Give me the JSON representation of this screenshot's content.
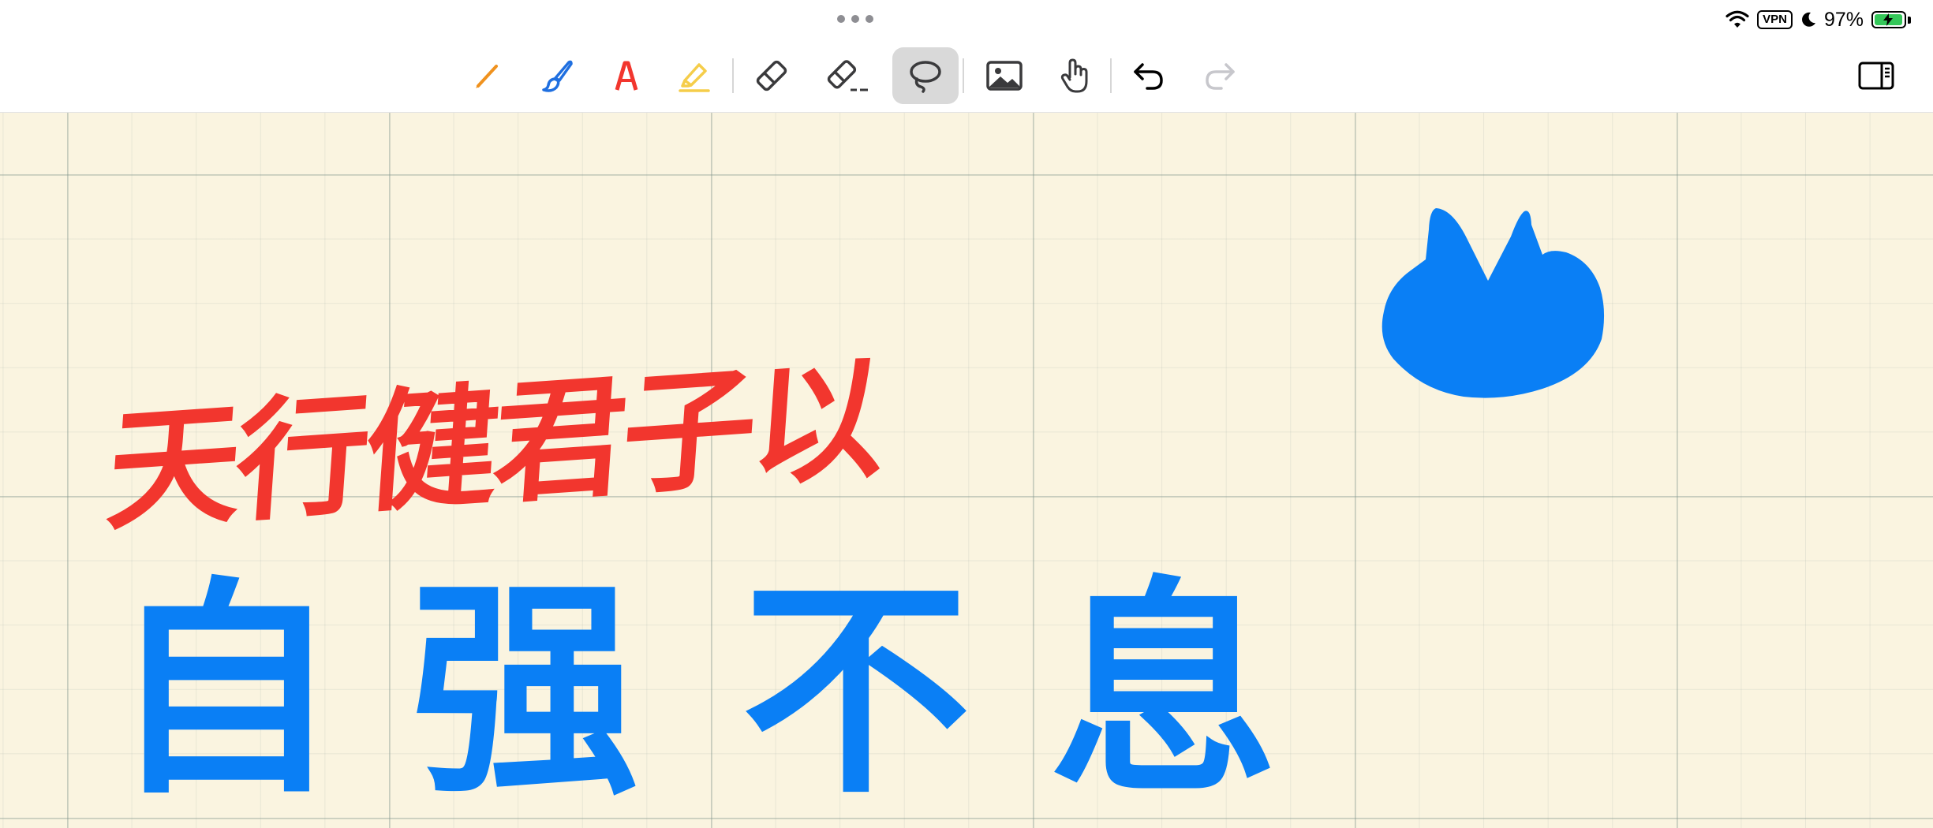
{
  "status_bar": {
    "more_icon": "ellipsis-icon",
    "wifi_icon": "wifi-icon",
    "vpn_label": "VPN",
    "focus_icon": "moon-icon",
    "battery_percent": "97%",
    "battery_level": 0.97,
    "battery_icon": "battery-charging-icon"
  },
  "toolbar": {
    "tools": [
      {
        "id": "pencil",
        "icon": "pencil-icon",
        "color": "#f0921e"
      },
      {
        "id": "brush",
        "icon": "brush-icon",
        "color": "#1f6fe0"
      },
      {
        "id": "pen",
        "icon": "pen-nib-icon",
        "color": "#f2362e"
      },
      {
        "id": "highlighter",
        "icon": "highlighter-icon",
        "color": "#f5cd4a"
      },
      {
        "id": "eraser",
        "icon": "eraser-icon"
      },
      {
        "id": "partial-eraser",
        "icon": "partial-eraser-icon"
      },
      {
        "id": "lasso",
        "icon": "lasso-icon",
        "active": true
      },
      {
        "id": "image",
        "icon": "image-icon"
      },
      {
        "id": "hand",
        "icon": "hand-icon"
      },
      {
        "id": "undo",
        "icon": "undo-icon"
      },
      {
        "id": "redo",
        "icon": "redo-icon",
        "disabled": true
      }
    ],
    "panel_toggle_icon": "sidebar-right-icon"
  },
  "canvas": {
    "paper": "grid",
    "background_color": "#faf4e0",
    "red_text": "天行健君子以",
    "red_color": "#f2362e",
    "blue_chars": [
      "自",
      "强",
      "不",
      "息"
    ],
    "blue_color": "#0a7ff5",
    "drawing": "blue-ink-blob-shape"
  }
}
